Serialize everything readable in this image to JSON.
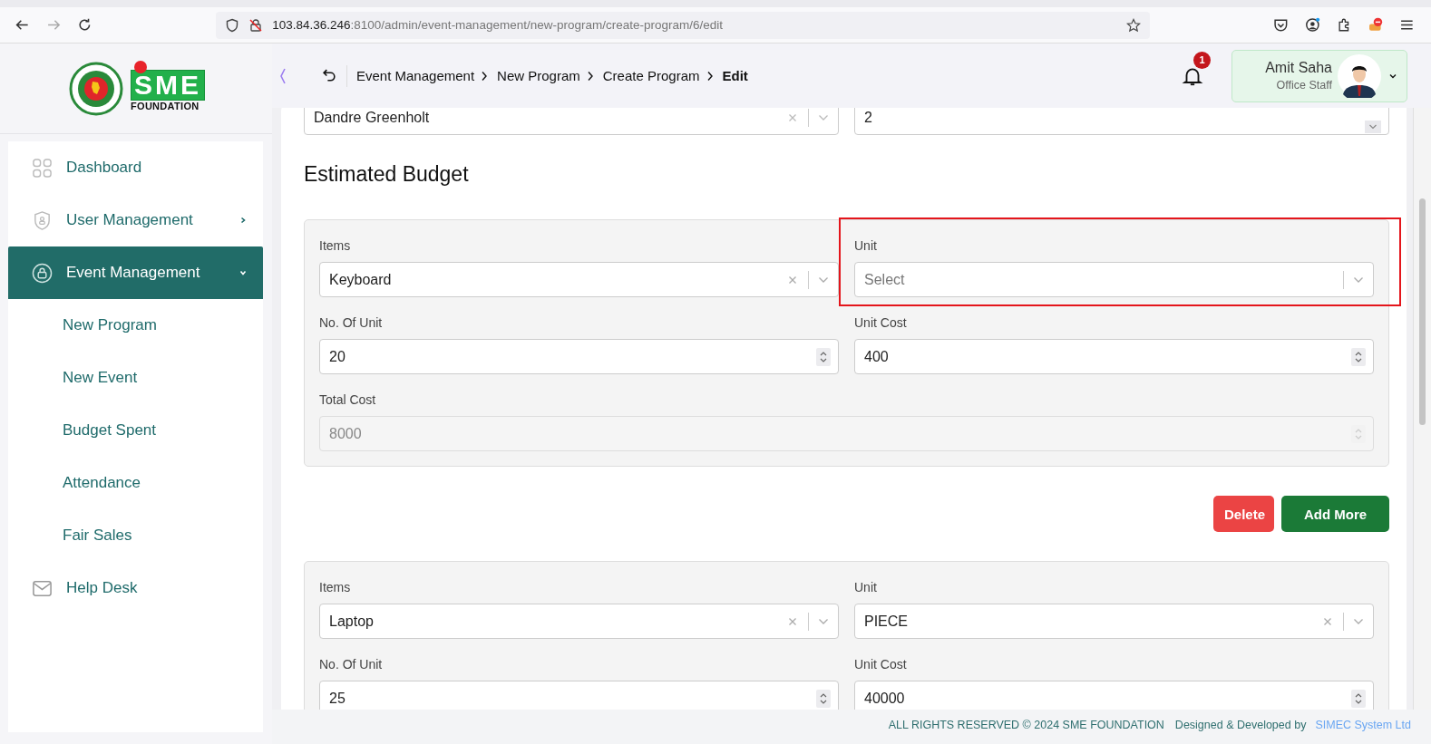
{
  "browser": {
    "url_host": "103.84.36.246",
    "url_rest": ":8100/admin/event-management/new-program/create-program/6/edit"
  },
  "logo": {
    "name": "SME",
    "subtitle": "FOUNDATION"
  },
  "sidebar": {
    "items": [
      {
        "label": "Dashboard",
        "kind": "grid",
        "selected": false
      },
      {
        "label": "User Management",
        "kind": "shield",
        "selected": false,
        "expanded": false
      },
      {
        "label": "Event Management",
        "kind": "lock",
        "selected": true,
        "expanded": true,
        "children": [
          {
            "label": "New Program",
            "selected": false
          },
          {
            "label": "New Event",
            "selected": false
          },
          {
            "label": "Budget Spent",
            "selected": false
          },
          {
            "label": "Attendance",
            "selected": false
          },
          {
            "label": "Fair Sales",
            "selected": false
          }
        ]
      },
      {
        "label": "Help Desk",
        "kind": "mail",
        "selected": false
      }
    ]
  },
  "breadcrumb": [
    "Event Management",
    "New Program",
    "Create Program",
    "Edit"
  ],
  "notifications": {
    "count": "1"
  },
  "user": {
    "name": "Amit Saha",
    "role": "Office Staff"
  },
  "top_fields": [
    {
      "kind": "select",
      "value": "Dandre Greenholt",
      "clearable": true
    },
    {
      "kind": "select",
      "value": "2",
      "clearable": false
    }
  ],
  "section_title": "Estimated Budget",
  "budget_items": [
    {
      "fields": [
        {
          "label": "Items",
          "kind": "select",
          "value": "Keyboard",
          "clearable": true
        },
        {
          "label": "Unit",
          "kind": "select",
          "placeholder": "Select",
          "clearable": false,
          "highlighted": true
        },
        {
          "label": "No. Of Unit",
          "kind": "number",
          "value": "20"
        },
        {
          "label": "Unit Cost",
          "kind": "number",
          "value": "400"
        },
        {
          "label": "Total Cost",
          "kind": "number",
          "value": "8000",
          "disabled": true,
          "wide": true
        }
      ],
      "buttons": [
        {
          "label": "Delete",
          "kind": "danger"
        },
        {
          "label": "Add More",
          "kind": "primary"
        }
      ]
    },
    {
      "fields": [
        {
          "label": "Items",
          "kind": "select",
          "value": "Laptop",
          "clearable": true
        },
        {
          "label": "Unit",
          "kind": "select",
          "value": "PIECE",
          "clearable": true
        },
        {
          "label": "No. Of Unit",
          "kind": "number",
          "value": "25"
        },
        {
          "label": "Unit Cost",
          "kind": "number",
          "value": "40000"
        }
      ]
    }
  ],
  "footer": {
    "rights": "ALL RIGHTS RESERVED © 2024 SME FOUNDATION",
    "designed": "Designed & Developed by",
    "developer": "SIMEC System Ltd"
  }
}
